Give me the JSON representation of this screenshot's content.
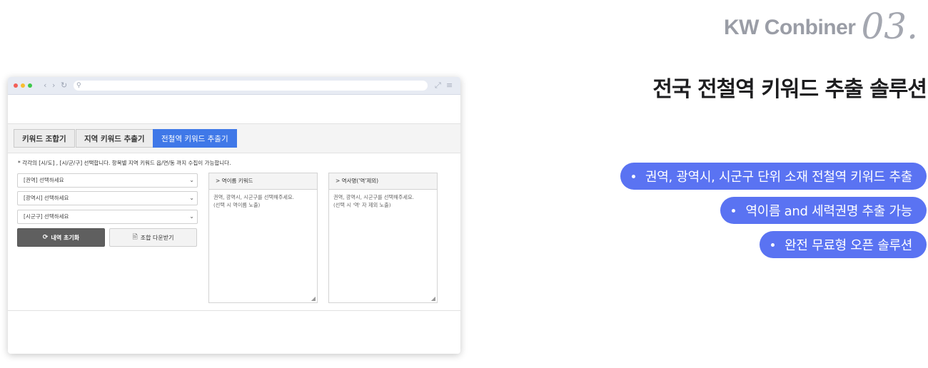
{
  "brand": {
    "name": "KW Conbiner",
    "number": "03."
  },
  "headline": "전국 전철역 키워드 추출 솔루션",
  "features": [
    "권역, 광역시, 시군구 단위 소재 전철역 키워드 추출",
    "역이름 and 세력권명 추출 가능",
    "완전 무료형 오픈 솔루션"
  ],
  "colors": {
    "accent": "#5a73f2",
    "tab_active": "#3f78e8",
    "reset_button": "#5f5f5f"
  },
  "browser": {
    "icons": [
      "back-icon",
      "forward-icon",
      "reload-icon",
      "search-icon",
      "expand-icon",
      "menu-icon"
    ],
    "tabs": [
      "키워드 조합기",
      "지역 키워드 추출기",
      "전철역 키워드 추출기"
    ],
    "active_tab": "전철역 키워드 추출기",
    "note": "* 각각의 [시/도] , [시/군/구] 선택합니다. 항목별 지역 키워드 읍/면/동 까지 수집이 가능합니다.",
    "selects": [
      "[권역] 선택하세요",
      "[광역시] 선택하세요",
      "[시군구] 선택하세요"
    ],
    "reset_label": "내역 초기화",
    "download_label": "조합 다운받기",
    "panel1": {
      "title": "> 역이름 키워드",
      "line1": "권역, 광역시, 시군구를 선택해주세요.",
      "line2": "(선택 시 역이름 노출)"
    },
    "panel2": {
      "title": "> 역사명('역'제외)",
      "line1": "권역, 광역시, 시군구를 선택해주세요.",
      "line2": "(선택 시 '역' 자 제외 노출)"
    }
  }
}
